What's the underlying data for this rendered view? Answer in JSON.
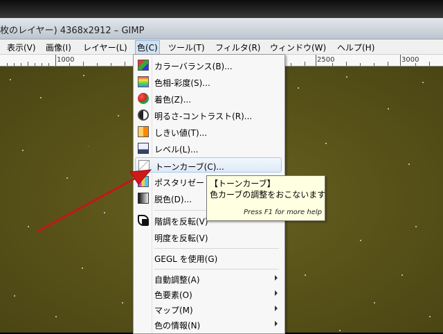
{
  "window": {
    "title": "枚のレイヤー) 4368x2912 – GIMP"
  },
  "menubar": {
    "items": [
      {
        "label": "表示(V)"
      },
      {
        "label": "画像(I)"
      },
      {
        "label": "レイヤー(L)"
      },
      {
        "label": "色(C)"
      },
      {
        "label": "ツール(T)"
      },
      {
        "label": "フィルタ(R)"
      },
      {
        "label": "ウィンドウ(W)"
      },
      {
        "label": "ヘルプ(H)"
      }
    ]
  },
  "ruler": {
    "labels": [
      "1000",
      "2500",
      "3000"
    ]
  },
  "colors_menu": {
    "items": [
      {
        "label": "カラーバランス(B)...",
        "icon": "color-balance-icon"
      },
      {
        "label": "色相-彩度(S)...",
        "icon": "hue-saturation-icon"
      },
      {
        "label": "着色(Z)...",
        "icon": "colorize-icon"
      },
      {
        "label": "明るさ-コントラスト(R)...",
        "icon": "brightness-contrast-icon"
      },
      {
        "label": "しきい値(T)...",
        "icon": "threshold-icon"
      },
      {
        "label": "レベル(L)...",
        "icon": "levels-icon"
      },
      {
        "label": "トーンカーブ(C)...",
        "icon": "curves-icon"
      },
      {
        "label": "ポスタリゼー",
        "icon": "posterize-icon"
      },
      {
        "label": "脱色(D)...",
        "icon": "desaturate-icon"
      },
      {
        "label": "階調を反転(V)",
        "icon": "invert-icon"
      },
      {
        "label": "明度を反転(V)",
        "icon": ""
      },
      {
        "label": "GEGL を使用(G)",
        "icon": ""
      },
      {
        "label": "自動調整(A)",
        "icon": "submenu-arrow"
      },
      {
        "label": "色要素(O)",
        "icon": "submenu-arrow"
      },
      {
        "label": "マップ(M)",
        "icon": "submenu-arrow"
      },
      {
        "label": "色の情報(N)",
        "icon": "submenu-arrow"
      }
    ]
  },
  "tooltip": {
    "title": "【トーンカーブ】",
    "description": "色カーブの調整をおこないます",
    "help_hint": "Press F1 for more help"
  },
  "colors": {
    "highlight_border": "#a8c8ea",
    "arrow": "#d01818",
    "tooltip_bg": "#ffffe1"
  }
}
